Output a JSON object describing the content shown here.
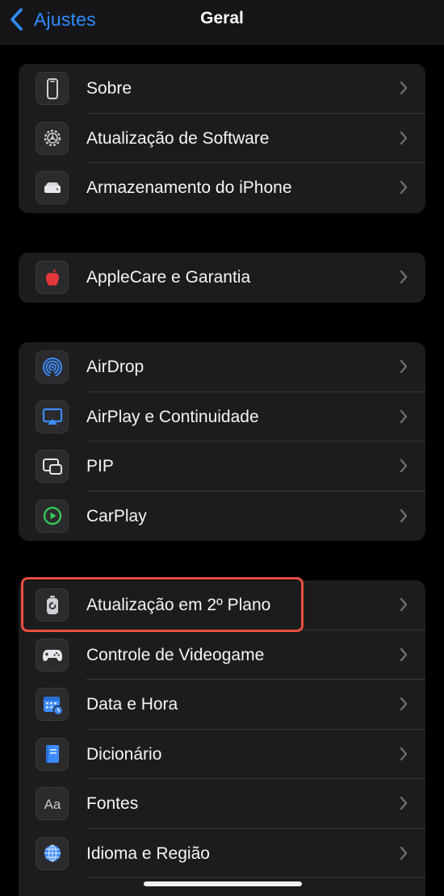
{
  "nav": {
    "back_label": "Ajustes",
    "title": "Geral"
  },
  "groups": [
    {
      "items": [
        {
          "label": "Sobre",
          "icon": "phone-icon"
        },
        {
          "label": "Atualização de Software",
          "icon": "gear-icon"
        },
        {
          "label": "Armazenamento do iPhone",
          "icon": "drive-icon"
        }
      ]
    },
    {
      "items": [
        {
          "label": "AppleCare e Garantia",
          "icon": "apple-icon"
        }
      ]
    },
    {
      "items": [
        {
          "label": "AirDrop",
          "icon": "airdrop-icon"
        },
        {
          "label": "AirPlay e Continuidade",
          "icon": "airplay-icon"
        },
        {
          "label": "PIP",
          "icon": "pip-icon"
        },
        {
          "label": "CarPlay",
          "icon": "carplay-icon"
        }
      ]
    },
    {
      "items": [
        {
          "label": "Atualização em 2º Plano",
          "icon": "background-refresh-icon"
        },
        {
          "label": "Controle de Videogame",
          "icon": "gamepad-icon"
        },
        {
          "label": "Data e Hora",
          "icon": "calendar-clock-icon"
        },
        {
          "label": "Dicionário",
          "icon": "book-icon"
        },
        {
          "label": "Fontes",
          "icon": "fonts-icon"
        },
        {
          "label": "Idioma e Região",
          "icon": "globe-icon"
        }
      ]
    }
  ],
  "colors": {
    "accent": "#2f8cff",
    "highlight": "#e8503e",
    "cell": "#1c1c1e"
  }
}
